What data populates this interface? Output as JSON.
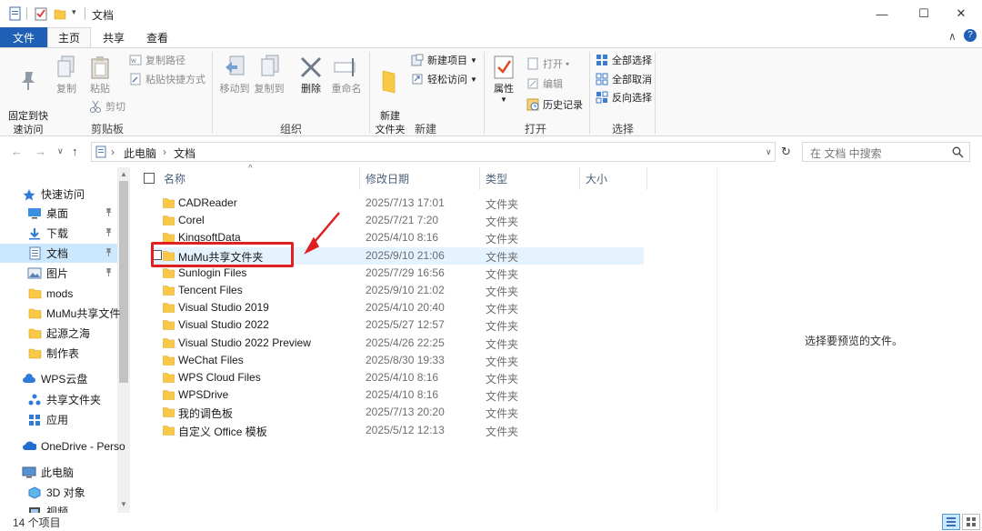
{
  "window": {
    "title": "文档",
    "controls": {
      "minimize": "—",
      "maximize": "☐",
      "close": "✕"
    }
  },
  "tabs": {
    "file": "文件",
    "home": "主页",
    "share": "共享",
    "view": "查看"
  },
  "ribbon": {
    "collapse_glyph": "∧",
    "help_glyph": "?",
    "clipboard": {
      "label": "剪贴板",
      "pin_quick_access": "固定到快\n速访问",
      "copy": "复制",
      "paste": "粘贴",
      "copy_path": "复制路径",
      "paste_shortcut": "粘贴快捷方式",
      "cut": "剪切"
    },
    "organize": {
      "label": "组织",
      "move_to": "移动到",
      "copy_to": "复制到",
      "delete": "删除",
      "rename": "重命名"
    },
    "new": {
      "label": "新建",
      "new_folder": "新建\n文件夹",
      "new_item": "新建项目",
      "easy_access": "轻松访问"
    },
    "open": {
      "label": "打开",
      "properties": "属性",
      "open": "打开",
      "edit": "编辑",
      "history": "历史记录"
    },
    "select": {
      "label": "选择",
      "select_all": "全部选择",
      "select_none": "全部取消",
      "invert_selection": "反向选择"
    }
  },
  "address": {
    "back": "←",
    "forward": "→",
    "recent": "∨",
    "up": "↑",
    "path": [
      "此电脑",
      "文档"
    ],
    "separator": "›",
    "dropdown": "∨",
    "refresh": "↻",
    "search_placeholder": "在 文档 中搜索"
  },
  "nav": {
    "items": [
      {
        "label": "快速访问",
        "icon": "star-icon",
        "pinned": false
      },
      {
        "label": "桌面",
        "icon": "desktop-icon",
        "pinned": true
      },
      {
        "label": "下载",
        "icon": "download-icon",
        "pinned": true
      },
      {
        "label": "文档",
        "icon": "document-icon",
        "pinned": true,
        "selected": true
      },
      {
        "label": "图片",
        "icon": "picture-icon",
        "pinned": true
      },
      {
        "label": "mods",
        "icon": "folder-icon",
        "pinned": false
      },
      {
        "label": "MuMu共享文件",
        "icon": "folder-icon",
        "pinned": false
      },
      {
        "label": "起源之海",
        "icon": "folder-icon",
        "pinned": false
      },
      {
        "label": "制作表",
        "icon": "folder-icon",
        "pinned": false
      },
      {
        "label": "WPS云盘",
        "icon": "cloud-icon",
        "pinned": false
      },
      {
        "label": "共享文件夹",
        "icon": "share-icon",
        "pinned": false
      },
      {
        "label": "应用",
        "icon": "apps-icon",
        "pinned": false
      },
      {
        "label": "OneDrive - Perso",
        "icon": "onedrive-icon",
        "pinned": false
      },
      {
        "label": "此电脑",
        "icon": "pc-icon",
        "pinned": false
      },
      {
        "label": "3D 对象",
        "icon": "3d-objects-icon",
        "pinned": false
      },
      {
        "label": "视频",
        "icon": "video-icon",
        "pinned": false
      }
    ],
    "pin_glyph": "📌"
  },
  "columns": {
    "name": "名称",
    "date": "修改日期",
    "type": "类型",
    "size": "大小",
    "sort_glyph": "^"
  },
  "files": [
    {
      "name": "CADReader",
      "date": "2025/7/13 17:01",
      "type": "文件夹"
    },
    {
      "name": "Corel",
      "date": "2025/7/21 7:20",
      "type": "文件夹"
    },
    {
      "name": "KingsoftData",
      "date": "2025/4/10 8:16",
      "type": "文件夹"
    },
    {
      "name": "MuMu共享文件夹",
      "date": "2025/9/10 21:06",
      "type": "文件夹",
      "selected": true
    },
    {
      "name": "Sunlogin Files",
      "date": "2025/7/29 16:56",
      "type": "文件夹"
    },
    {
      "name": "Tencent Files",
      "date": "2025/9/10 21:02",
      "type": "文件夹"
    },
    {
      "name": "Visual Studio 2019",
      "date": "2025/4/10 20:40",
      "type": "文件夹"
    },
    {
      "name": "Visual Studio 2022",
      "date": "2025/5/27 12:57",
      "type": "文件夹"
    },
    {
      "name": "Visual Studio 2022 Preview",
      "date": "2025/4/26 22:25",
      "type": "文件夹"
    },
    {
      "name": "WeChat Files",
      "date": "2025/8/30 19:33",
      "type": "文件夹"
    },
    {
      "name": "WPS Cloud Files",
      "date": "2025/4/10 8:16",
      "type": "文件夹"
    },
    {
      "name": "WPSDrive",
      "date": "2025/4/10 8:16",
      "type": "文件夹"
    },
    {
      "name": "我的调色板",
      "date": "2025/7/13 20:20",
      "type": "文件夹"
    },
    {
      "name": "自定义 Office 模板",
      "date": "2025/5/12 12:13",
      "type": "文件夹"
    }
  ],
  "preview": {
    "empty_text": "选择要预览的文件。"
  },
  "status": {
    "item_count": "14 个项目"
  },
  "colors": {
    "accent": "#1f5fb5",
    "selection": "#cce8ff",
    "hover_row": "#e5f3ff",
    "annotation": "#e02020",
    "folder": "#f8c846"
  }
}
